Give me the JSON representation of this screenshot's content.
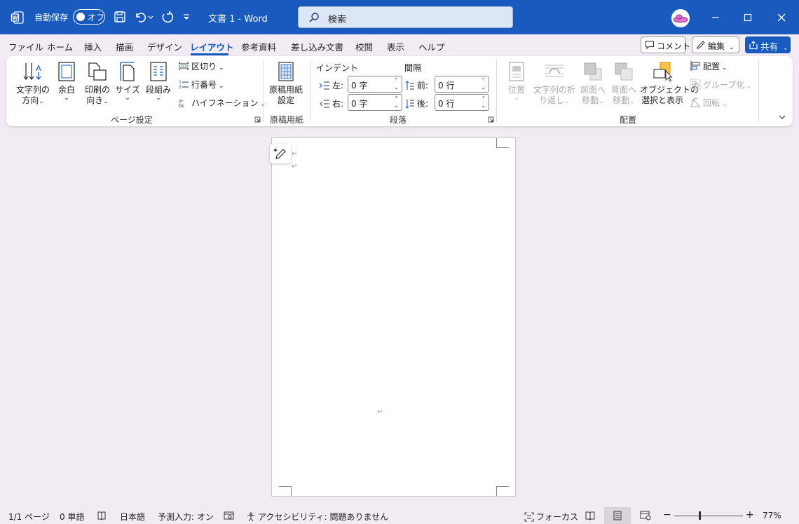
{
  "titlebar": {
    "autosave_label": "自動保存",
    "toggle_label": "オフ",
    "document_title": "文書 1  -  Word",
    "search_placeholder": "検索"
  },
  "tabs": [
    "ファイル",
    "ホーム",
    "挿入",
    "描画",
    "デザイン",
    "レイアウト",
    "参考資料",
    "差し込み文書",
    "校閲",
    "表示",
    "ヘルプ"
  ],
  "active_tab": "レイアウト",
  "header_buttons": {
    "comment": "コメント",
    "edit": "編集",
    "share": "共有"
  },
  "ribbon": {
    "page_setup": {
      "text_direction": [
        "文字列の",
        "方向"
      ],
      "margins": "余白",
      "orientation": [
        "印刷の",
        "向き"
      ],
      "size": "サイズ",
      "columns": "段組み",
      "breaks": "区切り",
      "line_numbers": "行番号",
      "hyphenation": "ハイフネーション",
      "label": "ページ設定"
    },
    "genko": {
      "button": [
        "原稿用紙",
        "設定"
      ],
      "label": "原稿用紙"
    },
    "paragraph": {
      "indent_header": "インデント",
      "spacing_header": "間隔",
      "left_label": "左:",
      "left_value": "0 字",
      "right_label": "右:",
      "right_value": "0 字",
      "before_label": "前:",
      "before_value": "0 行",
      "after_label": "後:",
      "after_value": "0 行",
      "label": "段落"
    },
    "arrange": {
      "position": "位置",
      "wrap_text": [
        "文字列の折",
        "り返し"
      ],
      "bring_forward": [
        "前面へ",
        "移動"
      ],
      "send_backward": [
        "背面へ",
        "移動"
      ],
      "selection_pane": [
        "オブジェクトの",
        "選択と表示"
      ],
      "align": "配置",
      "group": "グループ化",
      "rotate": "回転",
      "label": "配置"
    }
  },
  "status": {
    "page": "1/1 ページ",
    "words": "0 単語",
    "language": "日本語",
    "predictive": "予測入力: オン",
    "accessibility": "アクセシビリティ: 問題ありません",
    "focus": "フォーカス",
    "zoom": "77%"
  },
  "colors": {
    "titlebar": "#185abd",
    "background": "#f3ebf3",
    "accent": "#185abd"
  }
}
